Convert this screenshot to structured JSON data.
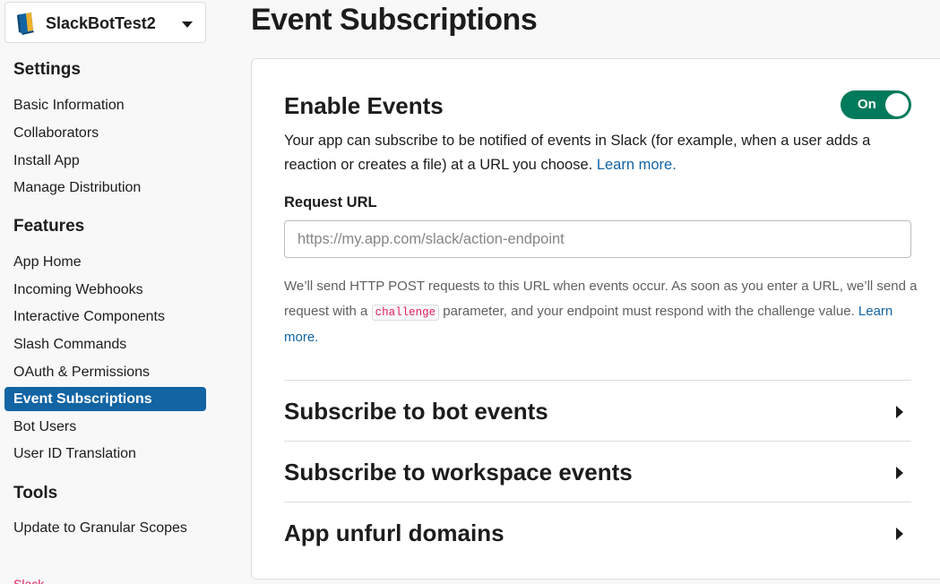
{
  "sidebar": {
    "app_name": "SlackBotTest2",
    "sections": [
      {
        "title": "Settings",
        "items": [
          "Basic Information",
          "Collaborators",
          "Install App",
          "Manage Distribution"
        ]
      },
      {
        "title": "Features",
        "items": [
          "App Home",
          "Incoming Webhooks",
          "Interactive Components",
          "Slash Commands",
          "OAuth & Permissions",
          "Event Subscriptions",
          "Bot Users",
          "User ID Translation"
        ]
      },
      {
        "title": "Tools",
        "items": [
          "Update to Granular Scopes"
        ]
      }
    ],
    "active_item": "Event Subscriptions",
    "footer_fragment": "Slack"
  },
  "main": {
    "page_title": "Event Subscriptions",
    "enable": {
      "title": "Enable Events",
      "toggle_label": "On",
      "toggle_on": true,
      "description": "Your app can subscribe to be notified of events in Slack (for example, when a user adds a reaction or creates a file) at a URL you choose.",
      "learn_more": "Learn more."
    },
    "request_url": {
      "label": "Request URL",
      "value": "",
      "placeholder": "https://my.app.com/slack/action-endpoint",
      "help_before": "We’ll send HTTP POST requests to this URL when events occur. As soon as you enter a URL, we’ll send a request with a",
      "help_code": "challenge",
      "help_after": "parameter, and your endpoint must respond with the challenge value.",
      "learn_more": "Learn more."
    },
    "expanders": [
      "Subscribe to bot events",
      "Subscribe to workspace events",
      "App unfurl domains"
    ]
  },
  "colors": {
    "accent": "#1264a3",
    "toggle_on": "#007a5a",
    "code_text": "#e01e5a",
    "text": "#1d1c1d"
  },
  "icons": [
    "app-book-icon",
    "chevron-down-icon",
    "expand-arrow-icon"
  ]
}
